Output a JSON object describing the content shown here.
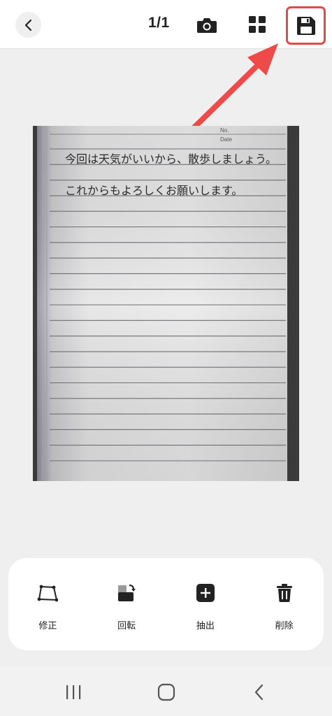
{
  "header": {
    "page_counter": "1/1",
    "back_icon": "chevron-left-icon",
    "camera_icon": "camera-icon",
    "grid_icon": "grid-icon",
    "save_icon": "floppy-disk-save-icon",
    "highlight_color": "#e24a4a"
  },
  "document": {
    "header_no": "No.",
    "header_date": "Date",
    "line1": "今回は天気がいいから、散歩しましょう。",
    "line2": "これからもよろしくお願いします。"
  },
  "tools": [
    {
      "label": "修正",
      "icon": "crop-adjust-icon"
    },
    {
      "label": "回転",
      "icon": "rotate-icon"
    },
    {
      "label": "抽出",
      "icon": "add-extract-icon"
    },
    {
      "label": "削除",
      "icon": "trash-icon"
    }
  ],
  "system_nav": {
    "recent_icon": "recent-apps-icon",
    "home_icon": "home-icon",
    "back_icon": "back-icon"
  }
}
